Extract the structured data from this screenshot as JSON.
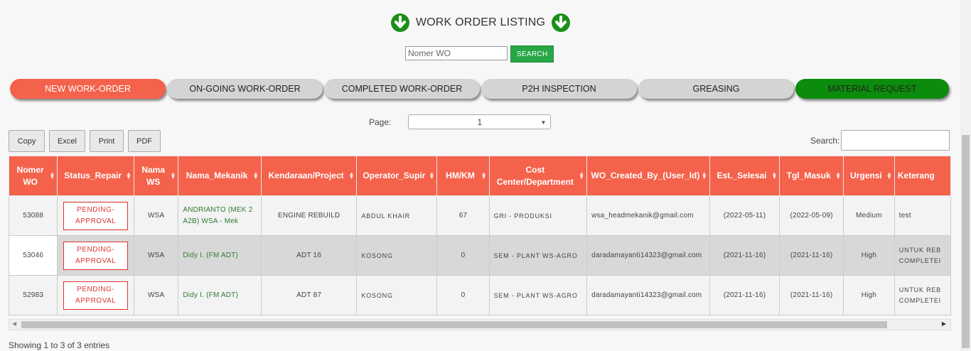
{
  "header": {
    "title": "WORK ORDER LISTING",
    "left_icon": "arrow-down-circle-icon",
    "right_icon": "arrow-down-circle-icon",
    "icon_color": "#1a8f1a"
  },
  "wo_search": {
    "placeholder": "Nomer WO",
    "value": "",
    "button_label": "SEARCH"
  },
  "tabs": [
    {
      "label": "NEW WORK-ORDER",
      "color": "#f4624b",
      "active": true
    },
    {
      "label": "ON-GOING WORK-ORDER",
      "color": "#d4d4d4"
    },
    {
      "label": "COMPLETED WORK-ORDER",
      "color": "#d4d4d4"
    },
    {
      "label": "P2H INSPECTION",
      "color": "#d4d4d4"
    },
    {
      "label": "GREASING",
      "color": "#d4d4d4"
    },
    {
      "label": "MATERIAL REQUEST",
      "color": "#0c8c0c"
    }
  ],
  "pager": {
    "label": "Page:",
    "selected": "1"
  },
  "export_buttons": [
    "Copy",
    "Excel",
    "Print",
    "PDF"
  ],
  "table_search": {
    "label": "Search:",
    "value": ""
  },
  "table": {
    "headers": [
      "Nomer WO",
      "Status_Repair",
      "Nama WS",
      "Nama_Mekanik",
      "Kendaraan/Project",
      "Operator_Supir",
      "HM/KM",
      "Cost Center/Department",
      "WO_Created_By_(User_Id)",
      "Est._Selesai",
      "Tgl_Masuk",
      "Urgensi",
      "Keterang"
    ],
    "rows": [
      {
        "nomer_wo": "53088",
        "status": "PENDING-APPROVAL",
        "nama_ws": "WSA",
        "mekanik": "ANDRIANTO (MEK 2 A2B) WSA - Mek",
        "kendaraan": "ENGINE REBUILD",
        "operator": "ABDUL KHAIR",
        "hmkm": "67",
        "cost_center": "GRI - PRODUKSI",
        "created_by": "wsa_headmekanik@gmail.com",
        "est_selesai": "(2022-05-11)",
        "tgl_masuk": "(2022-05-09)",
        "urgensi": "Medium",
        "keterangan": "test"
      },
      {
        "nomer_wo": "53046",
        "status": "PENDING-APPROVAL",
        "nama_ws": "WSA",
        "mekanik": "Didy I. (FM ADT)",
        "kendaraan": "ADT 16",
        "operator": "KOSONG",
        "hmkm": "0",
        "cost_center": "SEM - PLANT WS-AGRO",
        "created_by": "daradamayanti14323@gmail.com",
        "est_selesai": "(2021-11-16)",
        "tgl_masuk": "(2021-11-16)",
        "urgensi": "High",
        "keterangan": "UNTUK REB COMPLETEI"
      },
      {
        "nomer_wo": "52983",
        "status": "PENDING-APPROVAL",
        "nama_ws": "WSA",
        "mekanik": "Didy I. (FM ADT)",
        "kendaraan": "ADT 87",
        "operator": "KOSONG",
        "hmkm": "0",
        "cost_center": "SEM - PLANT WS-AGRO",
        "created_by": "daradamayanti14323@gmail.com",
        "est_selesai": "(2021-11-16)",
        "tgl_masuk": "(2021-11-16)",
        "urgensi": "High",
        "keterangan": "UNTUK REB COMPLETEI"
      }
    ]
  },
  "footer": {
    "info": "Showing 1 to 3 of 3 entries"
  }
}
